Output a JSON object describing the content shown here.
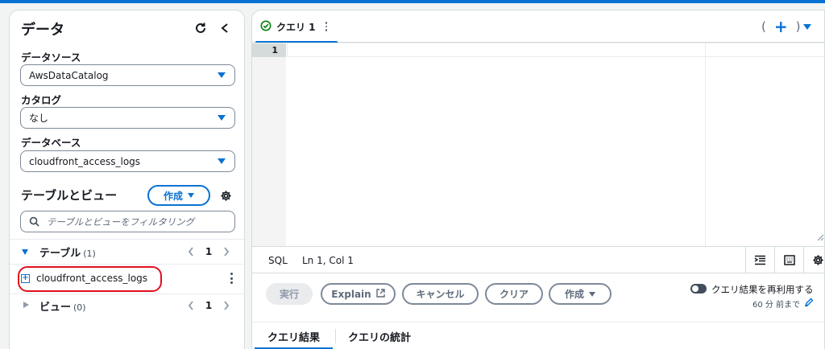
{
  "left_panel": {
    "title": "データ",
    "data_source": {
      "label": "データソース",
      "value": "AwsDataCatalog"
    },
    "catalog": {
      "label": "カタログ",
      "value": "なし"
    },
    "database": {
      "label": "データベース",
      "value": "cloudfront_access_logs"
    },
    "tables_views": {
      "title": "テーブルとビュー",
      "create_label": "作成",
      "filter_placeholder": "テーブルとビューをフィルタリング"
    },
    "tables_group": {
      "label": "テーブル",
      "count": "(1)",
      "page": "1"
    },
    "table_items": [
      {
        "name": "cloudfront_access_logs"
      }
    ],
    "views_group": {
      "label": "ビュー",
      "count": "(0)",
      "page": "1"
    }
  },
  "editor": {
    "tab_label": "クエリ 1",
    "open_paren": "(",
    "close_paren": ")",
    "line_number": "1",
    "status": {
      "language": "SQL",
      "position": "Ln 1, Col 1"
    }
  },
  "actions": {
    "run": "実行",
    "explain": "Explain",
    "cancel": "キャンセル",
    "clear": "クリア",
    "create": "作成",
    "reuse_label": "クエリ結果を再利用する",
    "reuse_sub": "60 分 前まで"
  },
  "result_tabs": [
    "クエリ結果",
    "クエリの統計"
  ],
  "colors": {
    "accent": "#0972d3",
    "highlight": "#e0101e",
    "success": "#037f0c"
  }
}
